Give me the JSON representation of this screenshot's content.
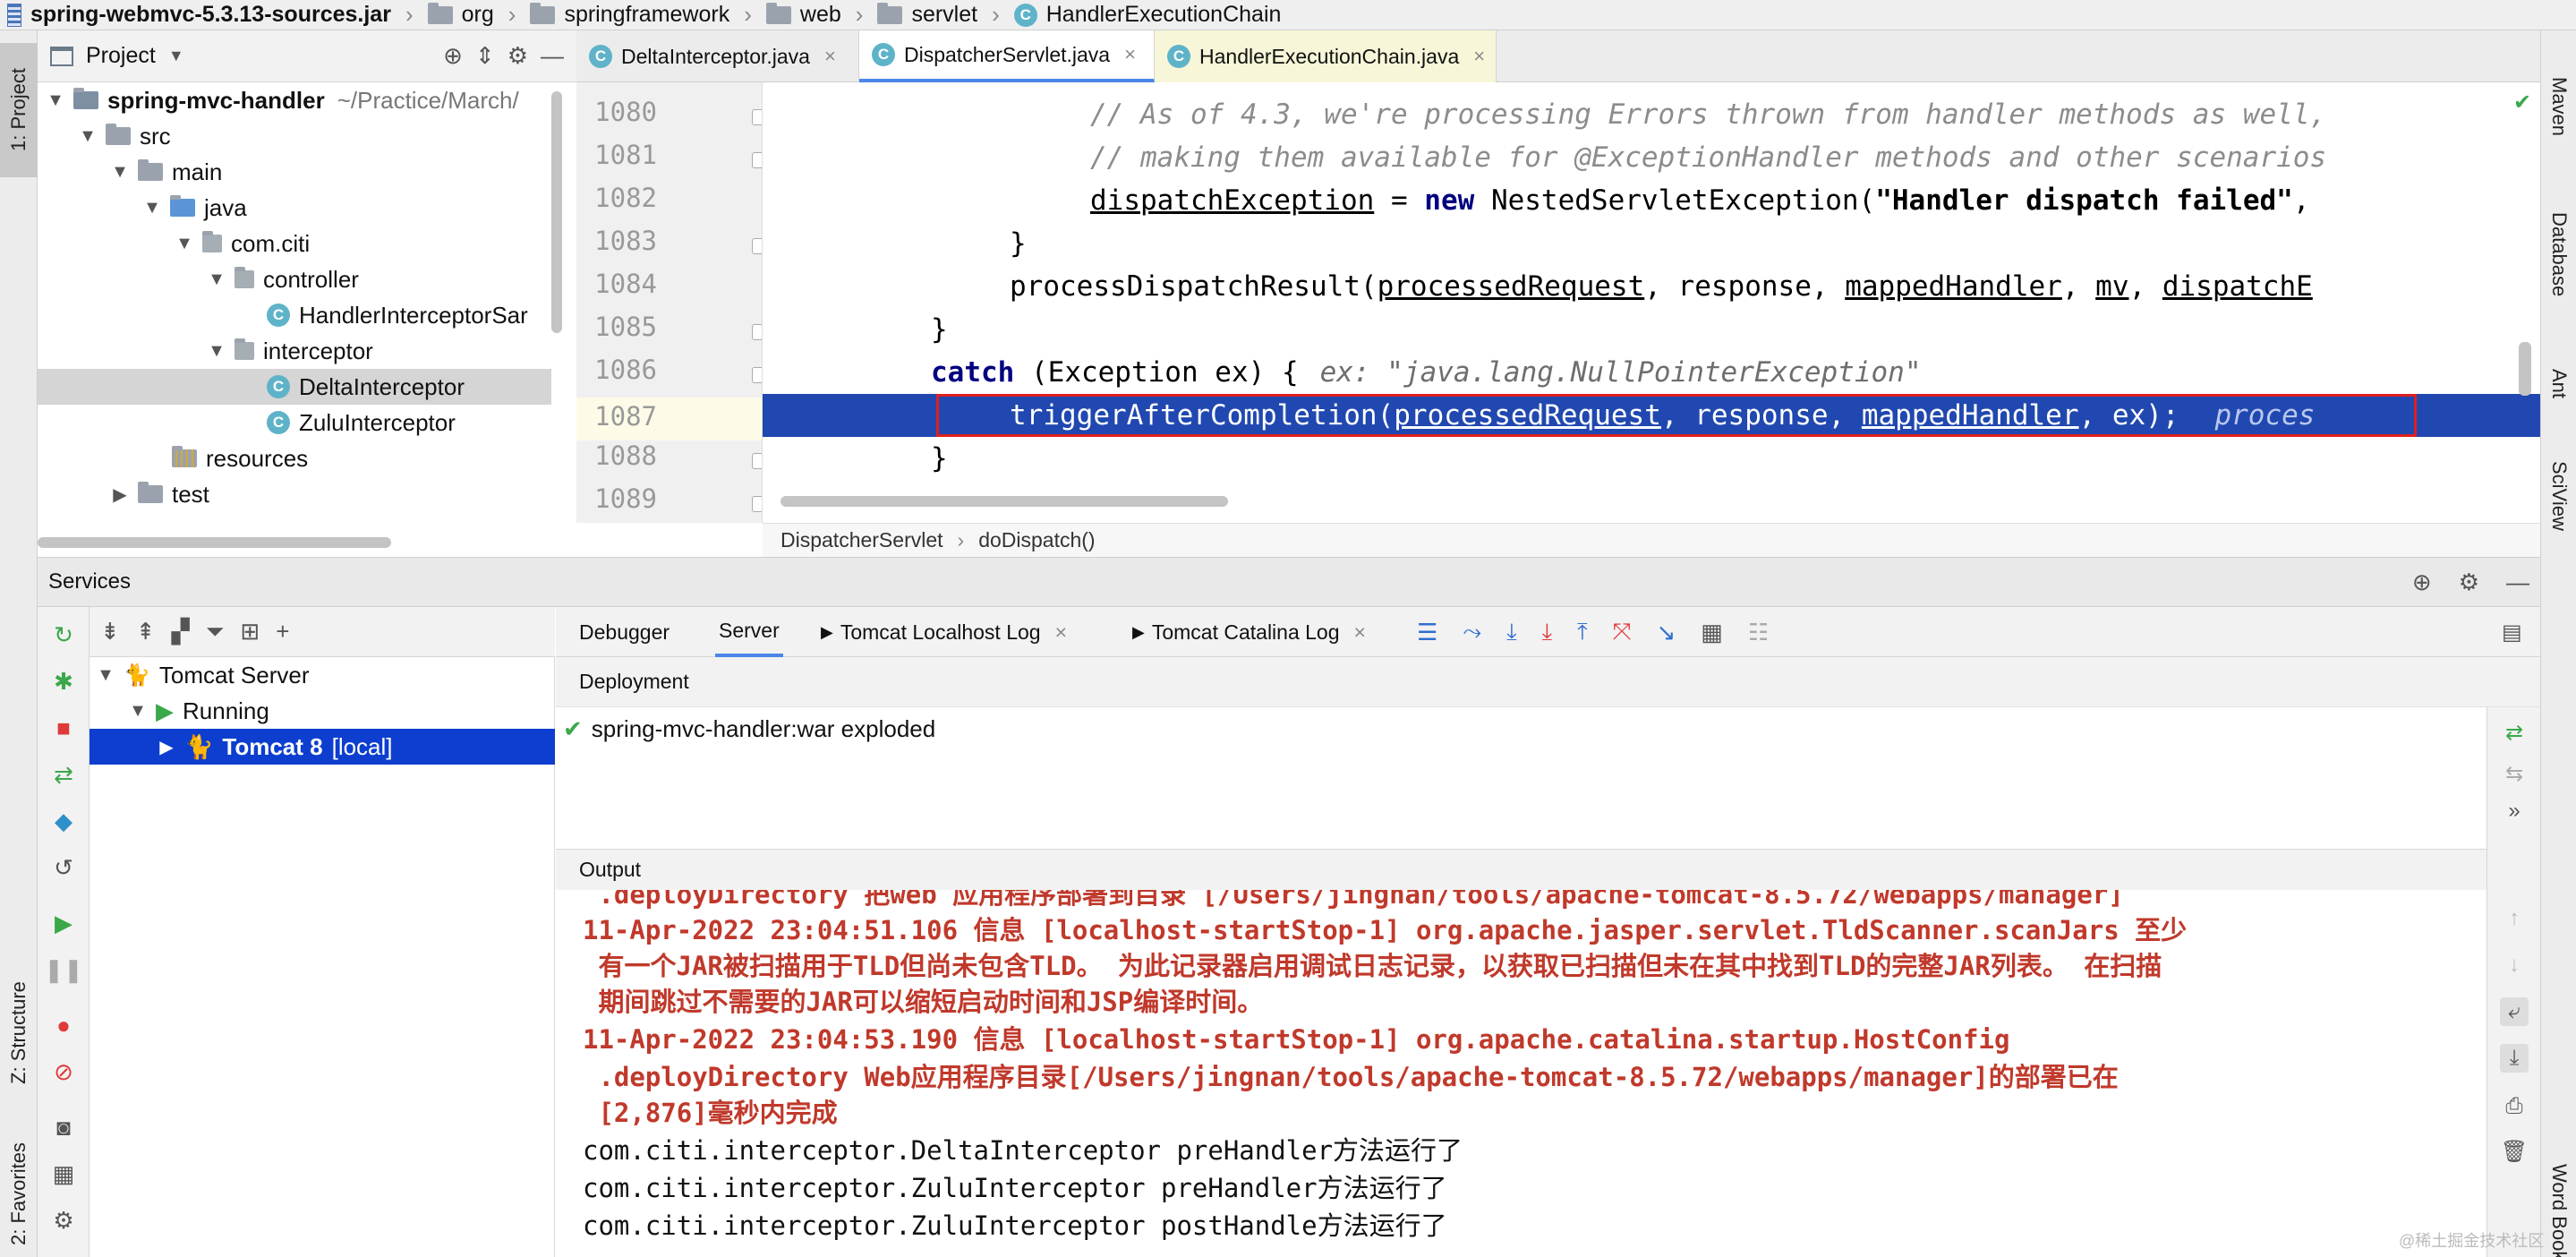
{
  "breadcrumbs": [
    {
      "label": "spring-webmvc-5.3.13-sources.jar",
      "icon": "jar-icon"
    },
    {
      "label": "org",
      "icon": "folder-icon"
    },
    {
      "label": "springframework",
      "icon": "folder-icon"
    },
    {
      "label": "web",
      "icon": "folder-icon"
    },
    {
      "label": "servlet",
      "icon": "folder-icon"
    },
    {
      "label": "HandlerExecutionChain",
      "icon": "class-icon"
    }
  ],
  "left_stripe": {
    "project": "1: Project",
    "structure": "Z: Structure",
    "favorites": "2: Favorites"
  },
  "right_stripe": {
    "maven": "Maven",
    "database": "Database",
    "ant": "Ant",
    "sciview": "SciView",
    "wordbook": "Word Book"
  },
  "project_panel": {
    "title": "Project",
    "tree": [
      {
        "label": "spring-mvc-handler",
        "extra": "~/Practice/March/",
        "indent": 0,
        "icon": "module-folder-icon",
        "bold": true,
        "arrow": "down"
      },
      {
        "label": "src",
        "indent": 1,
        "icon": "folder-icon",
        "arrow": "down"
      },
      {
        "label": "main",
        "indent": 2,
        "icon": "folder-icon",
        "arrow": "down"
      },
      {
        "label": "java",
        "indent": 3,
        "icon": "source-folder-icon",
        "arrow": "down"
      },
      {
        "label": "com.citi",
        "indent": 4,
        "icon": "package-icon",
        "arrow": "down"
      },
      {
        "label": "controller",
        "indent": 5,
        "icon": "package-icon",
        "arrow": "down"
      },
      {
        "label": "HandlerInterceptorSar",
        "indent": 6,
        "icon": "class-icon",
        "arrow": ""
      },
      {
        "label": "interceptor",
        "indent": 5,
        "icon": "package-icon",
        "arrow": "down"
      },
      {
        "label": "DeltaInterceptor",
        "indent": 6,
        "icon": "class-icon",
        "arrow": "",
        "selected": true
      },
      {
        "label": "ZuluInterceptor",
        "indent": 6,
        "icon": "class-icon",
        "arrow": ""
      },
      {
        "label": "resources",
        "indent": 3,
        "icon": "resources-folder-icon",
        "arrow": ""
      },
      {
        "label": "test",
        "indent": 2,
        "icon": "folder-icon",
        "arrow": "right"
      }
    ]
  },
  "editor": {
    "tabs": [
      {
        "label": "DeltaInterceptor.java",
        "active": false
      },
      {
        "label": "DispatcherServlet.java",
        "active": true
      },
      {
        "label": "HandlerExecutionChain.java",
        "active": false
      }
    ],
    "lines": [
      "1080",
      "1081",
      "1082",
      "1083",
      "1084",
      "1085",
      "1086",
      "1087",
      "1088",
      "1089"
    ],
    "code": {
      "l1080": "// As of 4.3, we're processing Errors thrown from handler methods as well,",
      "l1081": "// making them available for @ExceptionHandler methods and other scenarios",
      "l1082a": "dispatchException",
      "l1082b": " = ",
      "l1082c": "new",
      "l1082d": " NestedServletException(",
      "l1082e": "\"Handler dispatch failed\"",
      "l1082f": ",",
      "l1083": "}",
      "l1084a": "processDispatchResult(",
      "l1084b": "processedRequest",
      "l1084c": ", response, ",
      "l1084d": "mappedHandler",
      "l1084e": ", ",
      "l1084f": "mv",
      "l1084g": ", ",
      "l1084h": "dispatchE",
      "l1085": "}",
      "l1086a": "catch",
      "l1086b": " (Exception ex) {",
      "l1086c": "ex: \"java.lang.NullPointerException\"",
      "l1087a": "triggerAfterCompletion(",
      "l1087b": "processedRequest",
      "l1087c": ", response, ",
      "l1087d": "mappedHandler",
      "l1087e": ", ex);",
      "l1087f": "proces",
      "l1088": "}"
    },
    "breadcrumb": {
      "class": "DispatcherServlet",
      "method": "doDispatch()"
    }
  },
  "services": {
    "title": "Services",
    "tree": {
      "server": "Tomcat Server",
      "status": "Running",
      "instance": "Tomcat 8",
      "instance_suffix": "[local]"
    },
    "tabs": [
      "Debugger",
      "Server",
      "Tomcat Localhost Log",
      "Tomcat Catalina Log"
    ],
    "deployment_label": "Deployment",
    "deployment_item": "spring-mvc-handler:war exploded",
    "output_label": "Output",
    "output_lines": [
      {
        "text": " .deployDirectory 把web 应用程序部署到目录 [/Users/jingnan/tools/apache-tomcat-8.5.72/webapps/manager]",
        "style": "red"
      },
      {
        "text": "11-Apr-2022 23:04:51.106 信息 [localhost-startStop-1] org.apache.jasper.servlet.TldScanner.scanJars 至少",
        "style": "red"
      },
      {
        "text": " 有一个JAR被扫描用于TLD但尚未包含TLD。 为此记录器启用调试日志记录，以获取已扫描但未在其中找到TLD的完整JAR列表。 在扫描",
        "style": "red"
      },
      {
        "text": " 期间跳过不需要的JAR可以缩短启动时间和JSP编译时间。",
        "style": "red"
      },
      {
        "text": "11-Apr-2022 23:04:53.190 信息 [localhost-startStop-1] org.apache.catalina.startup.HostConfig",
        "style": "red"
      },
      {
        "text": " .deployDirectory Web应用程序目录[/Users/jingnan/tools/apache-tomcat-8.5.72/webapps/manager]的部署已在",
        "style": "red"
      },
      {
        "text": " [2,876]毫秒内完成",
        "style": "red"
      },
      {
        "text": "com.citi.interceptor.DeltaInterceptor preHandler方法运行了",
        "style": "plain"
      },
      {
        "text": "com.citi.interceptor.ZuluInterceptor preHandler方法运行了",
        "style": "plain"
      },
      {
        "text": "com.citi.interceptor.ZuluInterceptor postHandle方法运行了",
        "style": "plain"
      }
    ]
  },
  "watermark": "@稀土掘金技术社区",
  "colors": {
    "selection": "#0d3ecf",
    "exec_line": "#2148b0",
    "highlight_box": "#e01f1f",
    "keyword": "#0033b3",
    "string": "#067d17",
    "log_red": "#c0392b"
  }
}
